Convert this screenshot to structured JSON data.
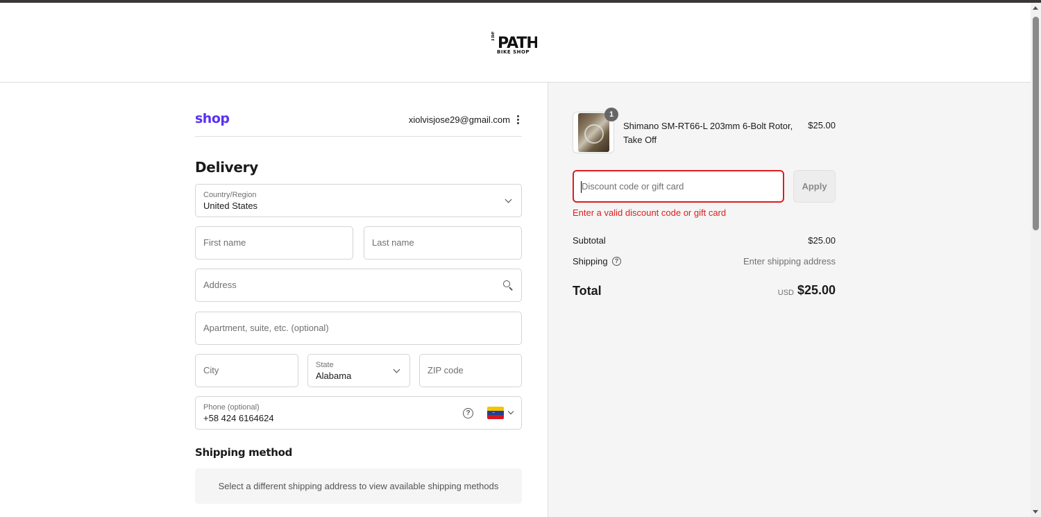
{
  "header": {
    "logo_text": "The PATH BIKE SHOP"
  },
  "account": {
    "shop_logo": "shop",
    "email": "xiolvisjose29@gmail.com"
  },
  "delivery": {
    "title": "Delivery",
    "country_label": "Country/Region",
    "country_value": "United States",
    "first_name_placeholder": "First name",
    "last_name_placeholder": "Last name",
    "address_placeholder": "Address",
    "apartment_placeholder": "Apartment, suite, etc. (optional)",
    "city_placeholder": "City",
    "state_label": "State",
    "state_value": "Alabama",
    "zip_placeholder": "ZIP code",
    "phone_label": "Phone (optional)",
    "phone_value": "+58 424 6164624",
    "phone_country_flag": "venezuela-flag-icon"
  },
  "shipping_method": {
    "title": "Shipping method",
    "notice": "Select a different shipping address to view available shipping methods"
  },
  "summary": {
    "product": {
      "name": "Shimano SM-RT66-L 203mm 6-Bolt Rotor, Take Off",
      "price": "$25.00",
      "quantity": "1"
    },
    "discount_placeholder": "Discount code or gift card",
    "apply_label": "Apply",
    "discount_error": "Enter a valid discount code or gift card",
    "subtotal_label": "Subtotal",
    "subtotal_value": "$25.00",
    "shipping_label": "Shipping",
    "shipping_value": "Enter shipping address",
    "total_label": "Total",
    "total_currency": "USD",
    "total_value": "$25.00"
  },
  "colors": {
    "shop_brand": "#5a31f4",
    "error": "#dd1d1d",
    "summary_bg": "#f5f5f5"
  }
}
